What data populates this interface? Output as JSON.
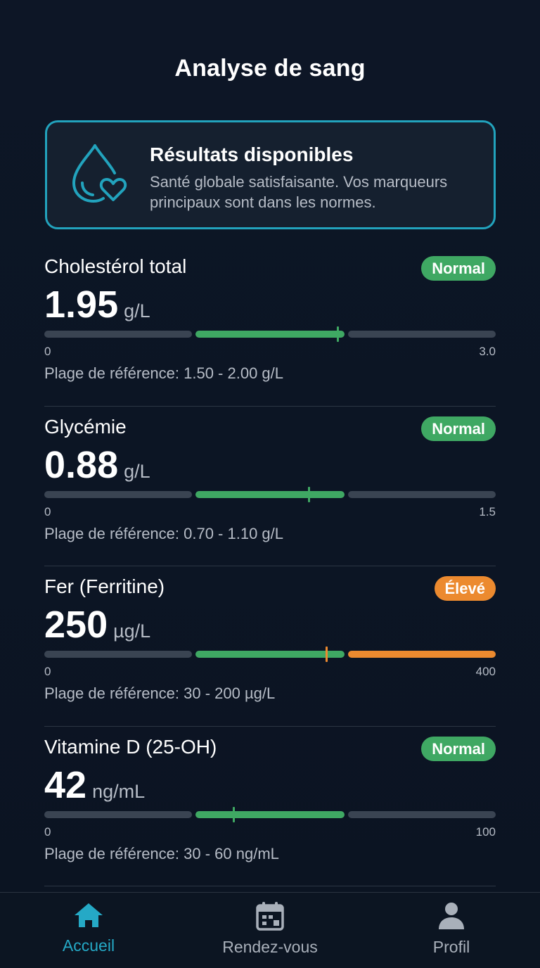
{
  "header": {
    "title": "Analyse de sang"
  },
  "summary": {
    "icon": "drop-heart-icon",
    "title": "Résultats disponibles",
    "text": "Santé globale satisfaisante. Vos marqueurs principaux sont dans les normes.",
    "accent_color": "#22a3bd"
  },
  "markers": [
    {
      "name": "Cholestérol total",
      "status": "Normal",
      "value": "1.95",
      "unit": "g/L",
      "scale_min": "0",
      "scale_max": "3.0",
      "reference": "Plage de référence: 1.50 - 2.00 g/L",
      "value_num": 1.95,
      "max_num": 3.0,
      "ref_low": 1.5,
      "ref_high": 2.0
    },
    {
      "name": "Glycémie",
      "status": "Normal",
      "value": "0.88",
      "unit": "g/L",
      "scale_min": "0",
      "scale_max": "1.5",
      "reference": "Plage de référence: 0.70 - 1.10 g/L",
      "value_num": 0.88,
      "max_num": 1.5,
      "ref_low": 0.7,
      "ref_high": 1.1
    },
    {
      "name": "Fer (Ferritine)",
      "status": "Élevé",
      "value": "250",
      "unit": "µg/L",
      "scale_min": "0",
      "scale_max": "400",
      "reference": "Plage de référence: 30 - 200 µg/L",
      "value_num": 250,
      "max_num": 400,
      "ref_low": 30,
      "ref_high": 200
    },
    {
      "name": "Vitamine D (25-OH)",
      "status": "Normal",
      "value": "42",
      "unit": "ng/mL",
      "scale_min": "0",
      "scale_max": "100",
      "reference": "Plage de référence: 30 - 60 ng/mL",
      "value_num": 42,
      "max_num": 100,
      "ref_low": 30,
      "ref_high": 60
    }
  ],
  "colors": {
    "normal": "#3fa863",
    "high": "#ec8a2f",
    "track": "#3a4452",
    "accent": "#25a9c6"
  },
  "nav": {
    "home": {
      "label": "Accueil",
      "icon": "home-icon",
      "active": true
    },
    "appointments": {
      "label": "Rendez-vous",
      "icon": "calendar-icon"
    },
    "profile": {
      "label": "Profil",
      "icon": "user-icon"
    }
  }
}
